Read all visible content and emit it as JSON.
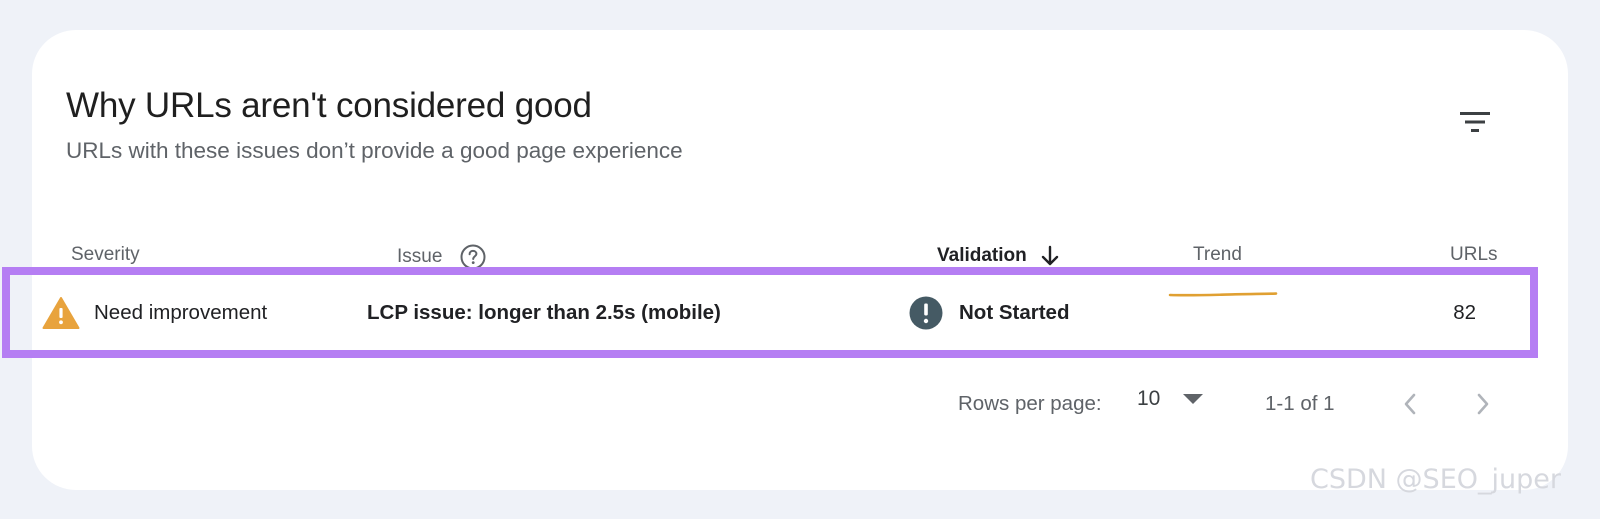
{
  "card": {
    "title": "Why URLs aren't considered good",
    "subtitle": "URLs with these issues don’t provide a good page experience",
    "filter_icon": "filter-icon"
  },
  "table": {
    "columns": {
      "severity": "Severity",
      "issue": "Issue",
      "validation": "Validation",
      "trend": "Trend",
      "urls": "URLs"
    },
    "sort_column": "validation",
    "rows": [
      {
        "severity": "Need improvement",
        "severity_icon": "warning-icon",
        "severity_color": "#e8a33d",
        "issue": "LCP issue: longer than 2.5s (mobile)",
        "validation": "Not Started",
        "validation_icon": "exclamation-circle-icon",
        "trend_color": "#e0a032",
        "urls": "82"
      }
    ]
  },
  "pagination": {
    "rows_per_page_label": "Rows per page:",
    "rows_per_page_value": "10",
    "range": "1-1 of 1"
  },
  "watermark": "CSDN @SEO_juper",
  "colors": {
    "highlight_border": "#b57ef3",
    "page_bg": "#eff2f8"
  }
}
